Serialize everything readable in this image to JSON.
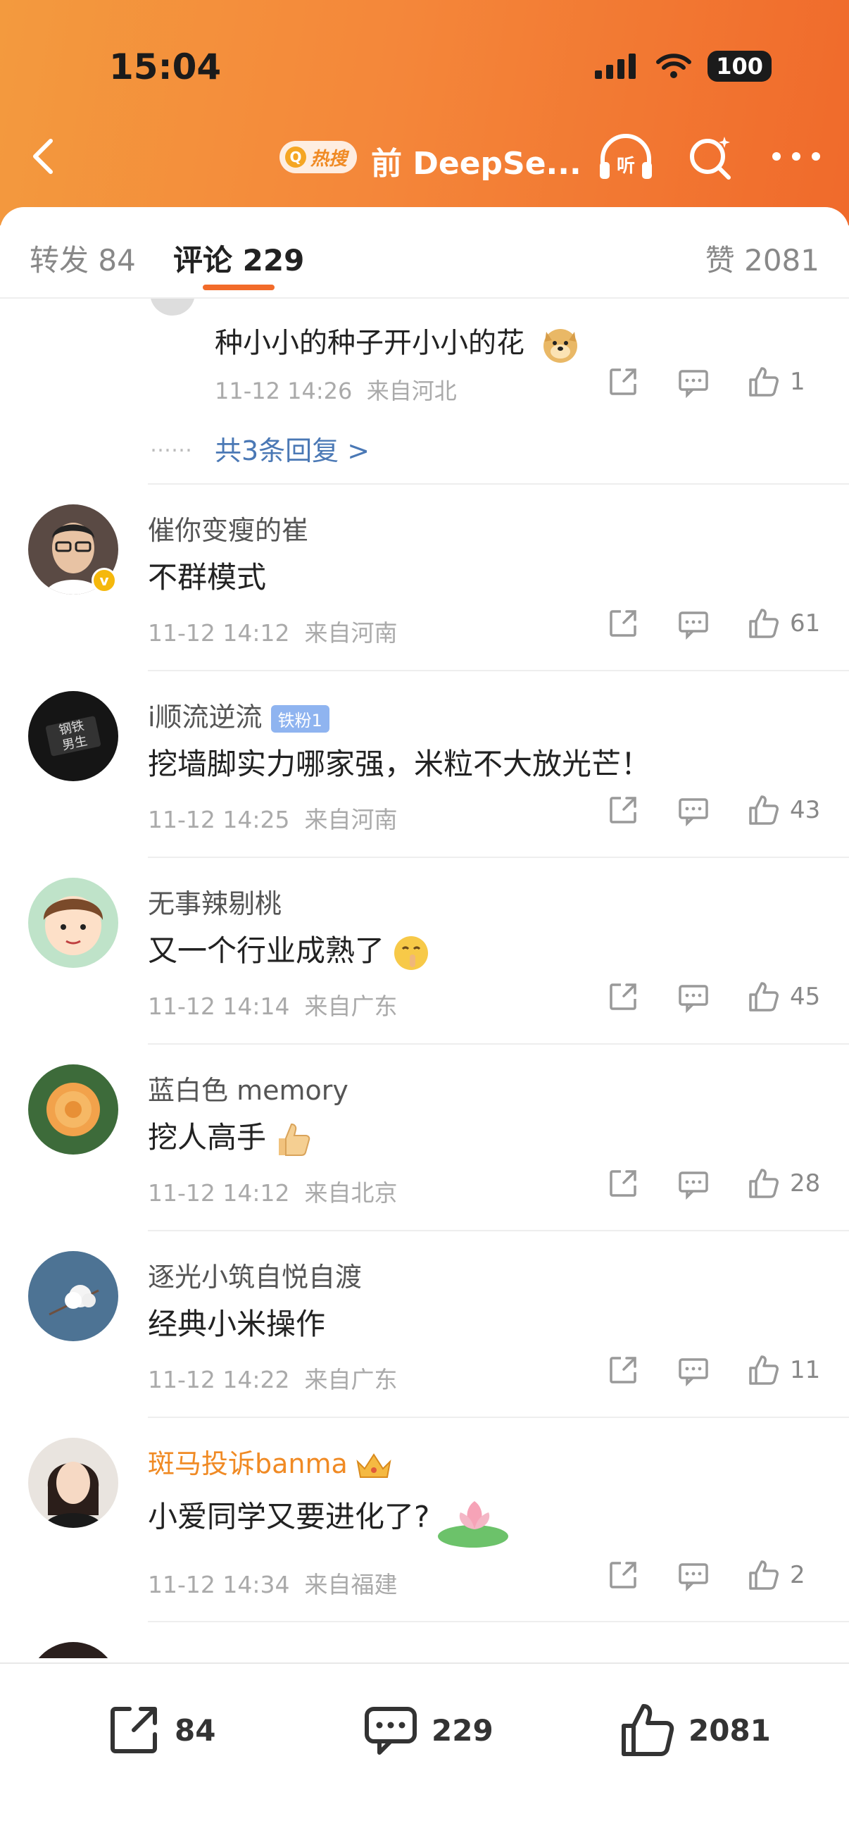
{
  "status": {
    "time": "15:04",
    "battery": "100"
  },
  "nav": {
    "hot_label": "热搜",
    "title": "前 DeepSe..."
  },
  "tabs": {
    "repost": "转发 84",
    "comments": "评论 229",
    "likes": "赞 2081"
  },
  "reply_fragment": {
    "text": "种小小的种子开小小的花",
    "time": "11-12 14:26",
    "location": "来自河北",
    "likes": "1",
    "dots": "……",
    "more_replies": "共3条回复 >"
  },
  "comments": [
    {
      "user": "催你变瘦的崔",
      "text": "不群模式",
      "time": "11-12 14:12",
      "location": "来自河南",
      "likes": "61"
    },
    {
      "user": "i顺流逆流",
      "badge": "铁粉1",
      "avatar_text": "钢铁\n男生",
      "text": "挖墙脚实力哪家强，米粒不大放光芒！",
      "time": "11-12 14:25",
      "location": "来自河南",
      "likes": "43"
    },
    {
      "user": "无事辣剔桃",
      "text": "又一个行业成熟了",
      "time": "11-12 14:14",
      "location": "来自广东",
      "likes": "45"
    },
    {
      "user": "蓝白色 memory",
      "text": "挖人高手",
      "time": "11-12 14:12",
      "location": "来自北京",
      "likes": "28"
    },
    {
      "user": "逐光小筑自悦自渡",
      "text": "经典小米操作",
      "time": "11-12 14:22",
      "location": "来自广东",
      "likes": "11"
    },
    {
      "user": "斑马投诉banma",
      "text": "小爱同学又要进化了?",
      "time": "11-12 14:34",
      "location": "来自福建",
      "likes": "2"
    }
  ],
  "bottom_bar": {
    "repost": "84",
    "comment": "229",
    "like": "2081"
  },
  "colors": {
    "header_start": "#f39a3e",
    "header_end": "#f06a2b",
    "accent": "#f26b2a",
    "link": "#4a78b5"
  }
}
